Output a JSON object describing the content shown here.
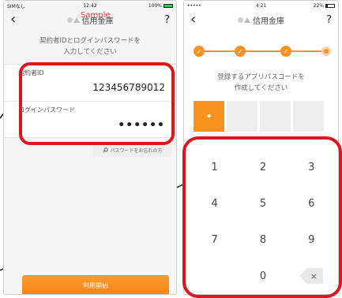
{
  "colors": {
    "accent": "#f7931e",
    "highlight": "#e0141e",
    "sample_tag": "#e53935"
  },
  "phone1": {
    "status": {
      "carrier": "SIMなし",
      "time": "12:42",
      "battery": "100%"
    },
    "nav": {
      "back_icon": "chevron-left-icon",
      "title": "信用金庫",
      "help": "?"
    },
    "sample_tag": "Sample",
    "instruction_line1": "契約者IDとログインパスワードを",
    "instruction_line2": "入力してください",
    "form": {
      "id_label": "契約者ID",
      "id_value": "123456789012",
      "pw_label": "ログインパスワード",
      "pw_value": "••••••"
    },
    "forgot_button": "パスワードをお忘れの方",
    "start_button": "利用開始"
  },
  "phone2": {
    "status": {
      "carrier": "••••• ",
      "time": "4:21",
      "battery": "22%"
    },
    "nav": {
      "back_icon": "chevron-left-icon",
      "title": "信用金庫",
      "help": "?"
    },
    "stepper": {
      "total": 4,
      "current": 4,
      "check": "✓"
    },
    "instruction_line1": "登録するアプリパスコードを",
    "instruction_line2": "作成してください",
    "pin": {
      "entered": 1,
      "length": 4,
      "dot": "•"
    },
    "keypad": [
      "1",
      "2",
      "3",
      "4",
      "5",
      "6",
      "7",
      "8",
      "9",
      "",
      "0",
      "×"
    ]
  }
}
